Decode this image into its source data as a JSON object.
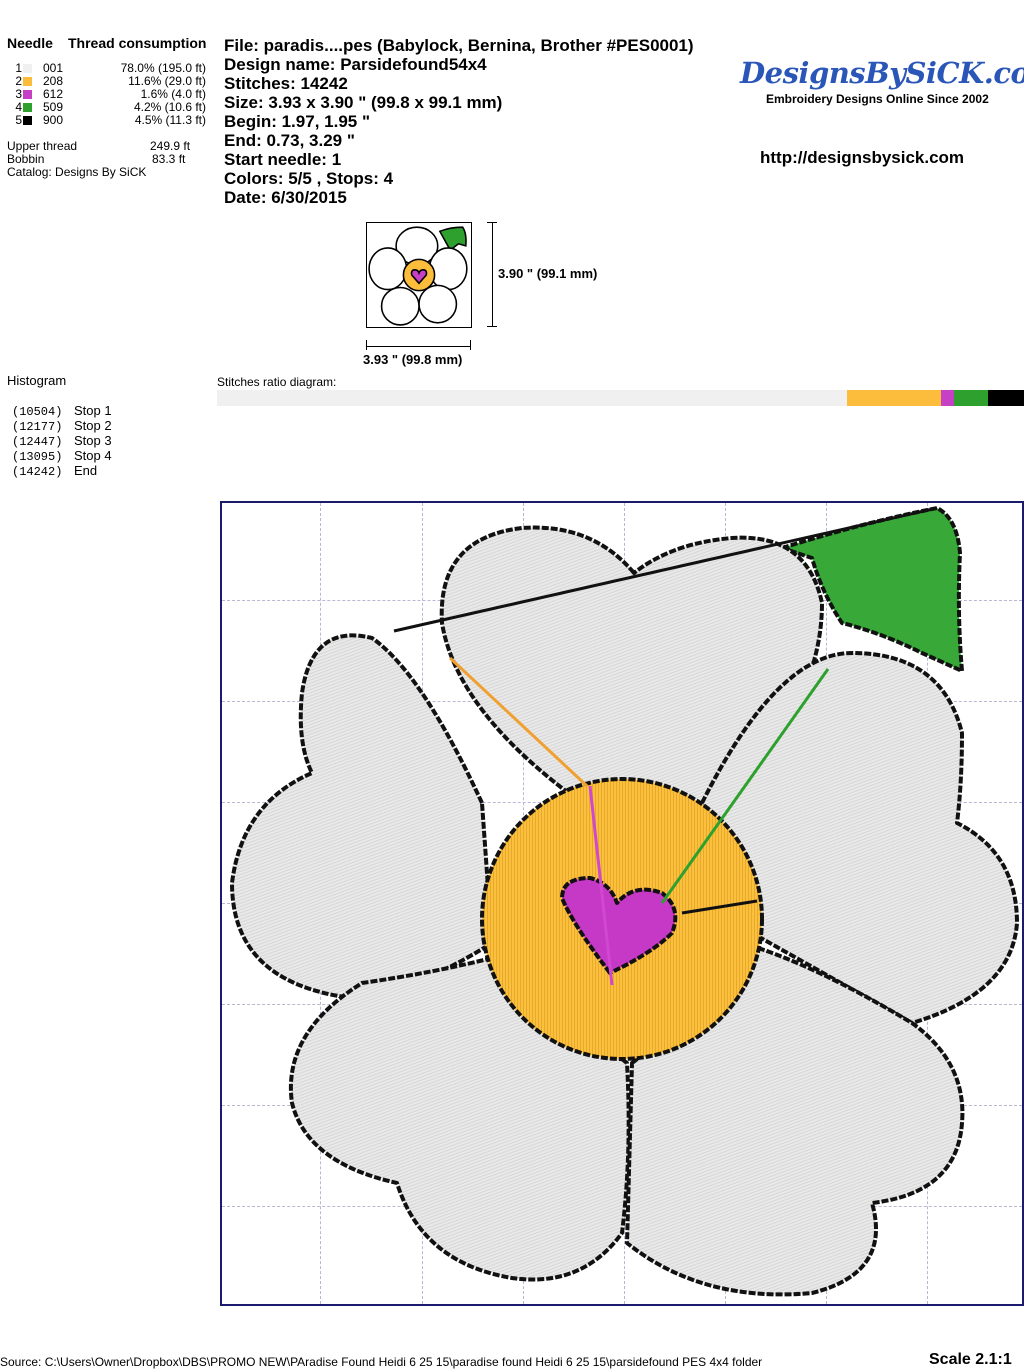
{
  "needles": {
    "header_needle": "Needle",
    "header_thread": "Thread consumption",
    "rows": [
      {
        "num": "1",
        "code": "001",
        "usage": "78.0% (195.0 ft)",
        "color": "#f0f0f0",
        "fraction": 0.78
      },
      {
        "num": "2",
        "code": "208",
        "usage": "11.6% (29.0 ft)",
        "color": "#fbbd3b",
        "fraction": 0.116
      },
      {
        "num": "3",
        "code": "612",
        "usage": "1.6% (4.0 ft)",
        "color": "#c540c5",
        "fraction": 0.016
      },
      {
        "num": "4",
        "code": "509",
        "usage": "4.2% (10.6 ft)",
        "color": "#2ea02e",
        "fraction": 0.042
      },
      {
        "num": "5",
        "code": "900",
        "usage": "4.5% (11.3 ft)",
        "color": "#000000",
        "fraction": 0.045
      }
    ],
    "upper_label": "Upper thread",
    "upper_value": "249.9 ft",
    "bobbin_label": "Bobbin",
    "bobbin_value": "83.3 ft",
    "catalog": "Catalog: Designs By SiCK"
  },
  "info": {
    "file": "File: paradis....pes  (Babylock, Bernina, Brother #PES0001)",
    "design": "Design name: Parsidefound54x4",
    "stitches": "Stitches: 14242",
    "size": "Size: 3.93 x 3.90 \" (99.8 x 99.1 mm)",
    "begin": "Begin: 1.97, 1.95 \"",
    "end": "End: 0.73, 3.29 \"",
    "start_needle": "Start needle: 1",
    "colors": "Colors: 5/5 , Stops: 4",
    "date": "Date: 6/30/2015"
  },
  "brand": {
    "logo": "DesignsBySiCK.com",
    "tagline": "Embroidery Designs Online Since 2002",
    "url": "http://designsbysick.com"
  },
  "thumb": {
    "height_label": "3.90 \" (99.1 mm)",
    "width_label": "3.93 \" (99.8 mm)"
  },
  "histogram": {
    "title": "Histogram",
    "rows": [
      {
        "count": "(10504)",
        "label": "Stop 1"
      },
      {
        "count": "(12177)",
        "label": "Stop 2"
      },
      {
        "count": "(12447)",
        "label": "Stop 3"
      },
      {
        "count": "(13095)",
        "label": "Stop 4"
      },
      {
        "count": "(14242)",
        "label": "End"
      }
    ]
  },
  "ratio": {
    "label": "Stitches ratio diagram:"
  },
  "footer": {
    "source": "Source: C:\\Users\\Owner\\Dropbox\\DBS\\PROMO NEW\\PAradise Found Heidi    6 25 15\\paradise found  Heidi     6 25 15\\parsidefound PES 4x4 folder",
    "scale": "Scale 2.1:1"
  }
}
